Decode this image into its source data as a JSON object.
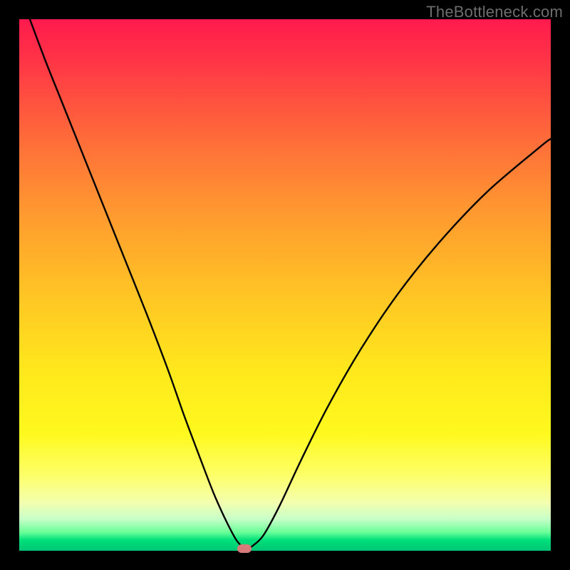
{
  "watermark": "TheBottleneck.com",
  "chart_data": {
    "type": "line",
    "title": "",
    "xlabel": "",
    "ylabel": "",
    "xlim": [
      0,
      100
    ],
    "ylim": [
      0,
      100
    ],
    "grid": false,
    "series": [
      {
        "name": "bottleneck-curve",
        "x": [
          2,
          5,
          8,
          12,
          16,
          20,
          24,
          28,
          31,
          34,
          36.5,
          38.5,
          40,
          41,
          42,
          43,
          44,
          46,
          49,
          53,
          58,
          64,
          71,
          79,
          88,
          98,
          100
        ],
        "values": [
          100,
          92,
          84.5,
          74.5,
          64.5,
          54.5,
          44.5,
          34,
          25.5,
          17.5,
          11,
          6.5,
          3.5,
          1.8,
          0.8,
          0.5,
          1,
          3,
          8.5,
          17,
          27,
          37.5,
          48,
          58,
          67.5,
          76,
          77.5
        ]
      }
    ],
    "annotations": [
      {
        "name": "optimal-marker",
        "x": 42.3,
        "y": 0.4,
        "shape": "rounded-rect",
        "color": "#d97a7a"
      }
    ],
    "background_gradient": {
      "top": "#ff1a4d",
      "mid": "#ffe81c",
      "bottom": "#00c574"
    }
  }
}
